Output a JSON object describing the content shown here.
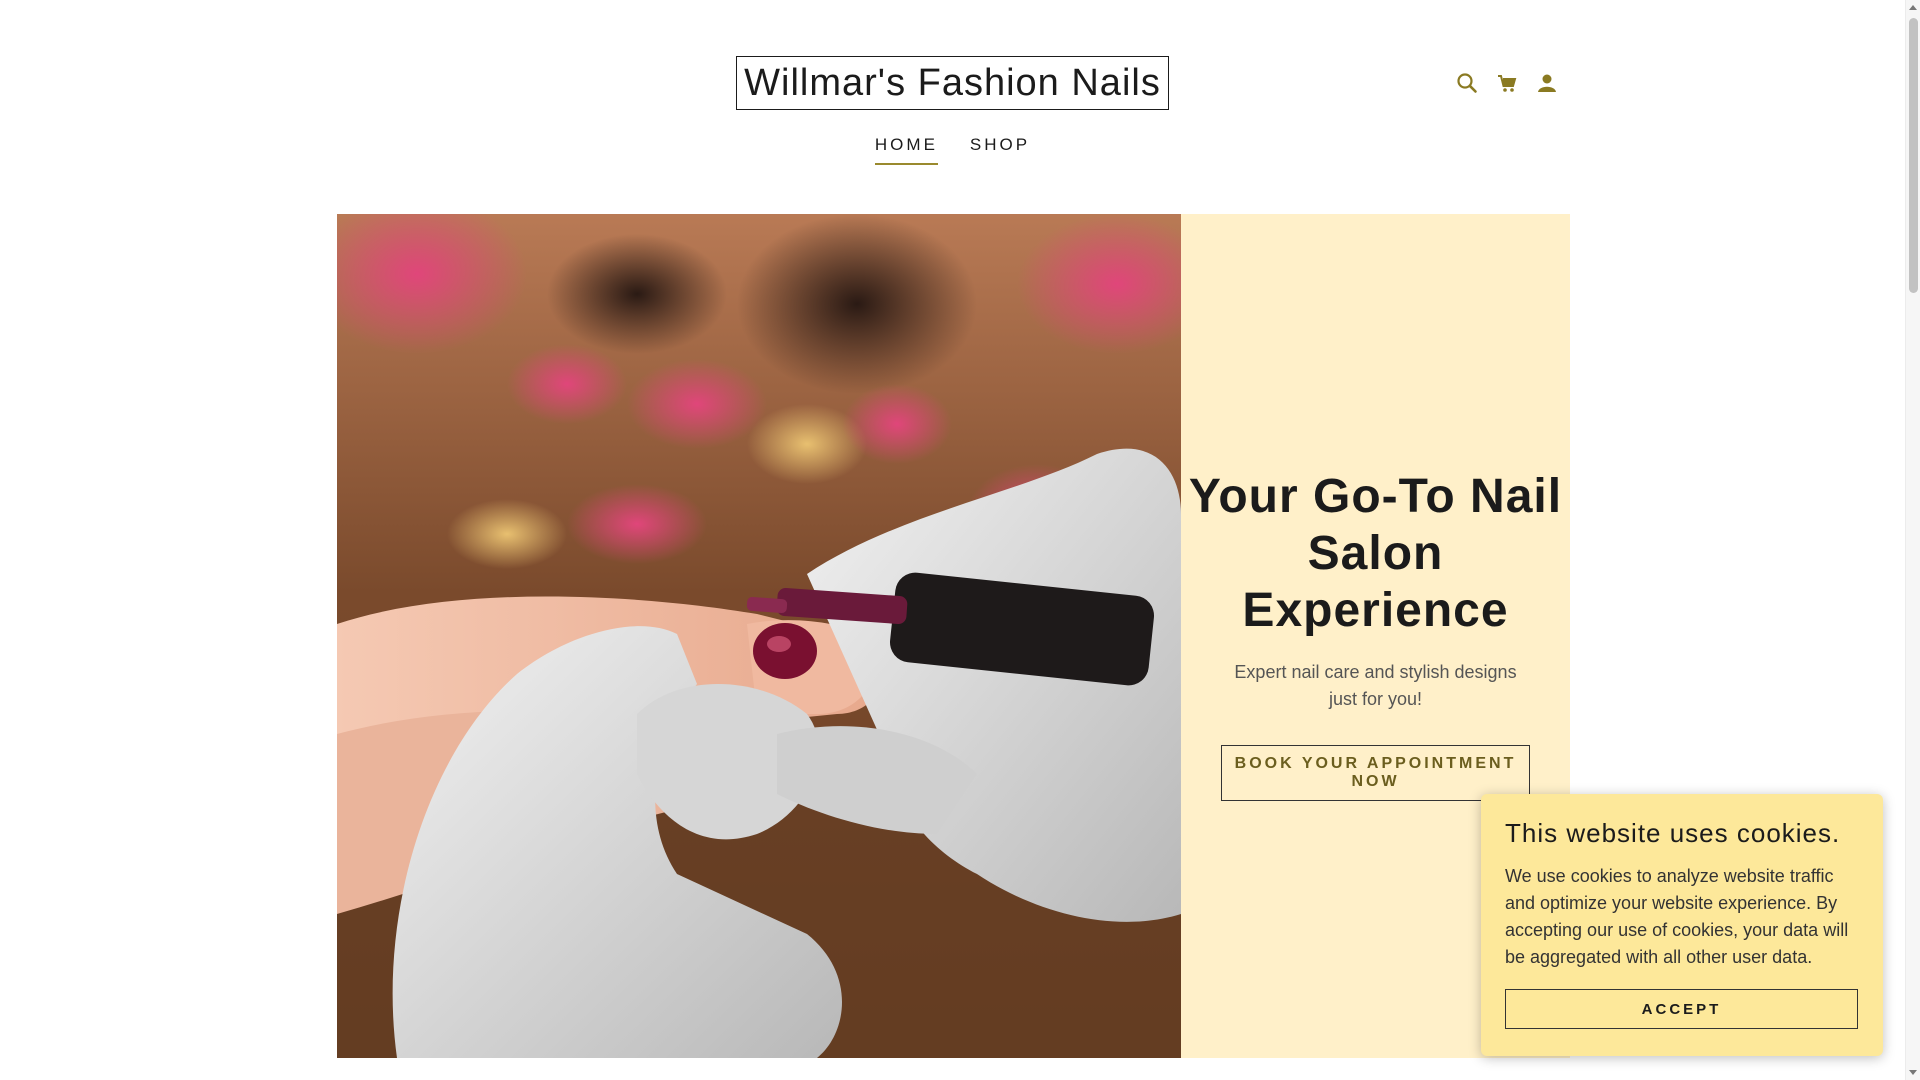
{
  "header": {
    "brand": "Willmar's Fashion Nails",
    "icons": [
      "search-icon",
      "cart-icon",
      "account-icon"
    ]
  },
  "nav": {
    "items": [
      {
        "label": "HOME",
        "active": true
      },
      {
        "label": "SHOP",
        "active": false
      }
    ]
  },
  "hero": {
    "image": "manicure-photo",
    "heading": "Your Go-To Nail Salon Experience",
    "subtext": "Expert nail care and stylish designs just for you!",
    "button_label": "BOOK YOUR APPOINTMENT NOW"
  },
  "cookie": {
    "title": "This website uses cookies.",
    "text": "We use cookies to analyze website traffic and optimize your website experience. By accepting our use of cookies, your data will be aggregated with all other user data.",
    "accept_label": "ACCEPT"
  },
  "colors": {
    "panel": "#fff0c9",
    "cookie_bg": "#fde89a",
    "nav_underline": "#9a8a2e",
    "button_text": "#6b5e1e"
  }
}
